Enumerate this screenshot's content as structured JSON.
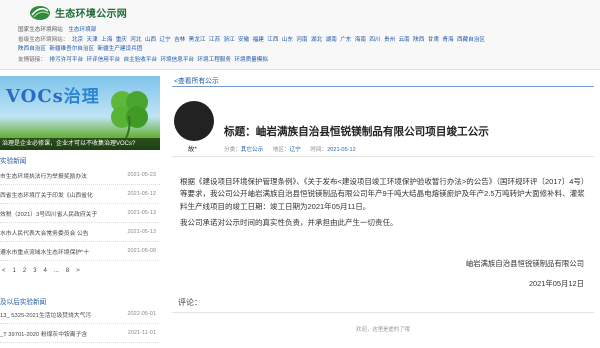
{
  "site": {
    "name": "生态环境公示网",
    "colors": {
      "brand_green": "#1e6b35",
      "link_blue": "#1b56a8"
    }
  },
  "header": {
    "row1": [
      "国家生态环境网站",
      "生态环境部"
    ],
    "row2_label": "省级生态环境网站：",
    "row2": [
      "北京",
      "天津",
      "上海",
      "重庆",
      "河北",
      "山西",
      "辽宁",
      "吉林",
      "黑龙江",
      "江苏",
      "浙江",
      "安徽",
      "福建",
      "江西",
      "山东",
      "河南",
      "湖北",
      "湖南",
      "广东",
      "海南",
      "四川",
      "贵州",
      "云南",
      "陕西",
      "甘肃",
      "青海",
      "西藏自治区"
    ],
    "row3": [
      "陕西自治区",
      "新疆维吾尔自治区",
      "新疆生产建设兵团"
    ],
    "row4_label": "友情链接：",
    "row4": [
      "排污许可平台",
      "环评信用平台",
      "自主验收平台",
      "环境信息平台",
      "环境工程服务",
      "环境质量模拟"
    ]
  },
  "sidebar": {
    "banner": {
      "title_en": "VOCs",
      "title_cn": "治理",
      "caption": "治理是企业必修课，企业才可以不收集治理VOCs?"
    },
    "news_title": "实验新闻",
    "news": [
      {
        "title": "市生态环境执法行为举报奖励办法",
        "date": "2021-05-23"
      },
      {
        "title": "西省生态环境厅关于印发《山西省化",
        "date": "2021-05-12"
      },
      {
        "title": "效税（2021）3号四川省人民政府关于",
        "date": "2021-05-13"
      },
      {
        "title": "水市人民代表大会常务委员会 公告",
        "date": "2021-05-13"
      },
      {
        "title": "遵水市重点流域水生态环境保护\"十",
        "date": "2021-05-09"
      }
    ],
    "pager": [
      "<",
      "1",
      "2",
      "3",
      "4",
      "...",
      "8",
      ">"
    ],
    "news2_title": "及以后实验新闻",
    "news2": [
      {
        "title": "13_ 5325-2021生活垃圾焚烧大气污",
        "date": "2022-05-01"
      },
      {
        "title": "_T 39701-2020 粉煤灰中铵离子含",
        "date": "2021-11-01"
      }
    ]
  },
  "main": {
    "back_link": "查看所有公示",
    "author": "故*",
    "title": "标题：岫岩满族自治县恒锐镁制品有限公司项目竣工公示",
    "meta": {
      "category_label": "分类：",
      "category": "其它公示",
      "region_label": "地区：",
      "region": "辽宁",
      "date_label": "时间：",
      "date": "2021-05-12"
    },
    "paragraphs": [
      "根据《建设项目环境保护管理条例》、《关于发布<建设项目竣工环境保护验收暂行办法>的公告》（国环规环评〔2017〕4号）等要求，我公司公开岫岩满族自治县恒锐镁制品有限公司年产9千吨大结晶电熔镁瘀炉及年产2.5万吨转炉大面修补料、灌浆料生产线项目的竣工日期：竣工日期为2021年05月11日。",
      "我公司承诺对公示时间的真实性负责，并承担由此产生一切责任。"
    ],
    "signature": "岫岩满族自治县恒锐镁制品有限公司",
    "sign_date": "2021年05月12日",
    "comment_label": "评论：",
    "comment_empty": "欢迎，这里是虚的了哦"
  }
}
